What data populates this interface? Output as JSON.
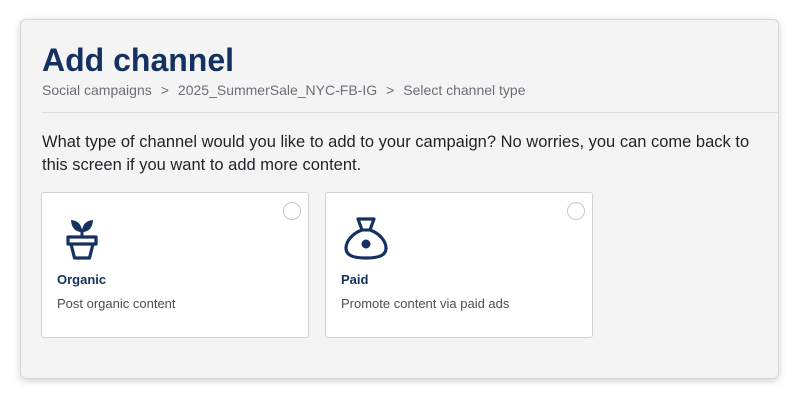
{
  "page": {
    "title": "Add channel",
    "breadcrumb": [
      "Social campaigns",
      "2025_SummerSale_NYC-FB-IG",
      "Select channel type"
    ],
    "separator": ">",
    "question": "What type of channel would you like to add to your campaign? No worries, you can come back to this screen if you want to add more content."
  },
  "options": [
    {
      "title": "Organic",
      "description": "Post organic content",
      "icon": "plant-pot-icon",
      "selected": false
    },
    {
      "title": "Paid",
      "description": "Promote content via paid ads",
      "icon": "money-bag-icon",
      "selected": false
    }
  ],
  "colors": {
    "brand": "#14315f",
    "background": "#f4f4f5",
    "card": "#ffffff",
    "muted_text": "#6b6f76"
  }
}
